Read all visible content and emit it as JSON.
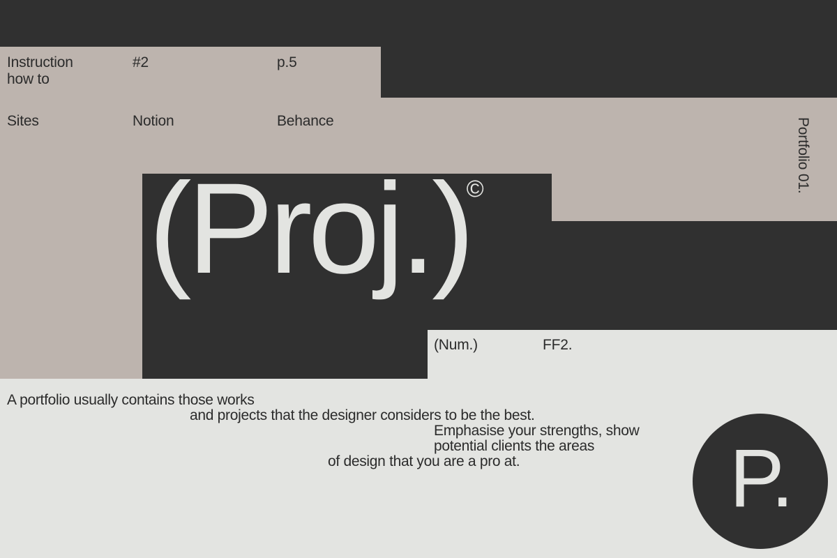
{
  "meta": {
    "document_title": "(Proj.)",
    "vertical_label": "Portfolio 01."
  },
  "header": {
    "row_primary": {
      "instruction": "Instruction\nhow to",
      "issue": "#2",
      "page": "p.5"
    },
    "row_secondary": {
      "category": "Sites",
      "link_one": "Notion",
      "link_two": "Behance"
    }
  },
  "title": {
    "text": "(Proj.)",
    "superscript": "©"
  },
  "spec_row": {
    "label": "(Num.)",
    "value": "FF2."
  },
  "body": {
    "lines": [
      "A portfolio usually contains those works",
      "and projects that the designer considers to be the best.",
      "Emphasise your strengths, show",
      "potential clients the areas",
      "of design that you are a pro at."
    ]
  },
  "badge": {
    "mark": "P."
  },
  "palette": {
    "dark": "#303030",
    "beige": "#BDB4AE",
    "light": "#E3E4E1",
    "ink": "#2b2b2b"
  }
}
